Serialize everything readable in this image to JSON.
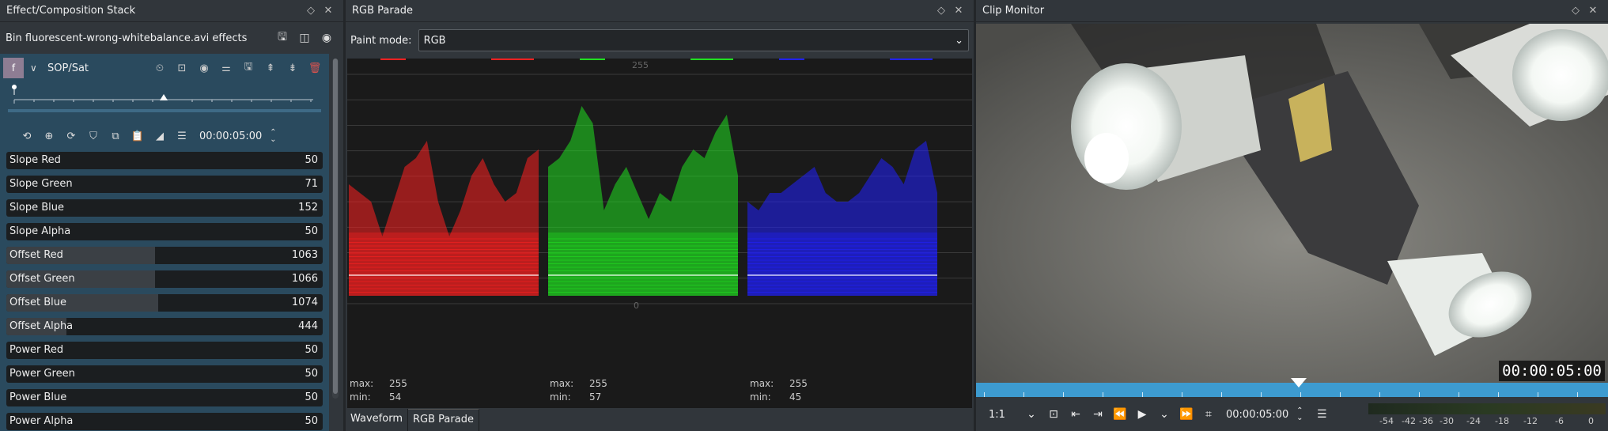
{
  "effects_panel": {
    "title": "Effect/Composition Stack",
    "bin_label": "Bin fluorescent-wrong-whitebalance.avi effects",
    "effect": {
      "toggle_letter": "f",
      "name": "SOP/Sat",
      "timecode": "00:00:05:00",
      "params": [
        {
          "label": "Slope Red",
          "value": "50",
          "fill": 0.0
        },
        {
          "label": "Slope Green",
          "value": "71",
          "fill": 0.0
        },
        {
          "label": "Slope Blue",
          "value": "152",
          "fill": 0.0
        },
        {
          "label": "Slope Alpha",
          "value": "50",
          "fill": 0.0
        },
        {
          "label": "Offset Red",
          "value": "1063",
          "fill": 0.47
        },
        {
          "label": "Offset Green",
          "value": "1066",
          "fill": 0.47
        },
        {
          "label": "Offset Blue",
          "value": "1074",
          "fill": 0.48
        },
        {
          "label": "Offset Alpha",
          "value": "444",
          "fill": 0.19
        },
        {
          "label": "Power Red",
          "value": "50",
          "fill": 0.0
        },
        {
          "label": "Power Green",
          "value": "50",
          "fill": 0.0
        },
        {
          "label": "Power Blue",
          "value": "50",
          "fill": 0.0
        },
        {
          "label": "Power Alpha",
          "value": "50",
          "fill": 0.0
        }
      ]
    }
  },
  "parade_panel": {
    "title": "RGB Parade",
    "paint_mode_label": "Paint mode:",
    "paint_mode_value": "RGB",
    "scale_top": "255",
    "scale_bottom": "0",
    "channels": [
      {
        "name": "red",
        "color": "#ff2020",
        "max_label": "max:",
        "max": "255",
        "min_label": "min:",
        "min": "54"
      },
      {
        "name": "green",
        "color": "#20e020",
        "max_label": "max:",
        "max": "255",
        "min_label": "min:",
        "min": "57"
      },
      {
        "name": "blue",
        "color": "#2020ff",
        "max_label": "max:",
        "max": "255",
        "min_label": "min:",
        "min": "45"
      }
    ],
    "tabs": [
      "Waveform",
      "RGB Parade"
    ],
    "active_tab": "RGB Parade"
  },
  "monitor_panel": {
    "title": "Clip Monitor",
    "timecode_overlay": "00:00:05:00",
    "zoom": "1:1",
    "timecode": "00:00:05:00",
    "meter_labels": [
      "-54",
      "-42",
      "-36",
      "-30",
      "-24",
      "-18",
      "-12",
      "-6",
      "0"
    ]
  }
}
